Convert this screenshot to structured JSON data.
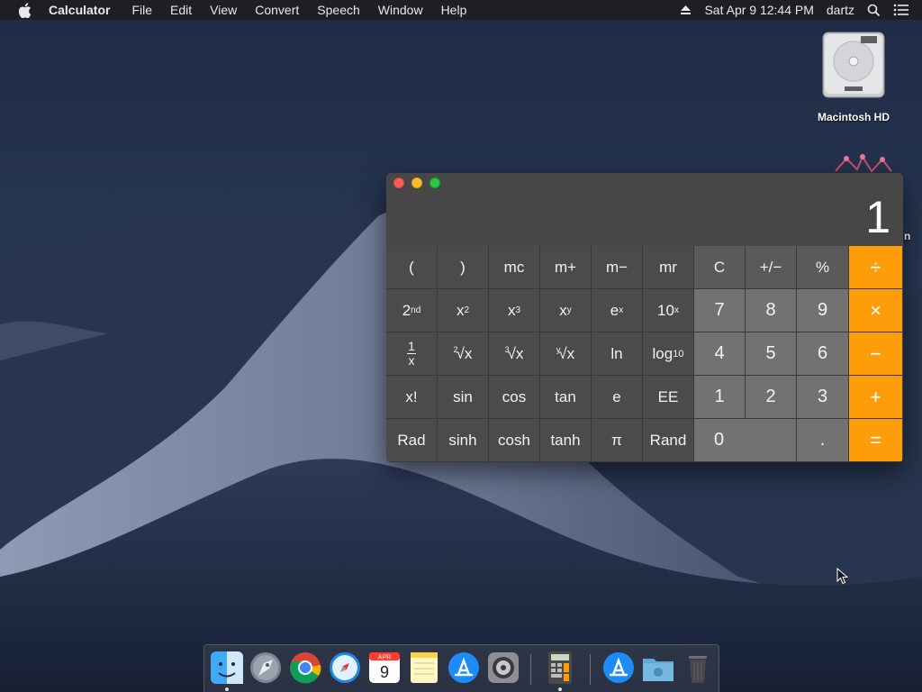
{
  "menubar": {
    "app_name": "Calculator",
    "menus": [
      "File",
      "Edit",
      "View",
      "Convert",
      "Speech",
      "Window",
      "Help"
    ],
    "datetime": "Sat Apr 9  12:44 PM",
    "user": "dartz"
  },
  "desktop": {
    "hd_label": "Macintosh HD",
    "partial_label": "n"
  },
  "calculator": {
    "display_value": "1",
    "rows": [
      [
        "(",
        ")",
        "mc",
        "m+",
        "m−",
        "mr",
        "C",
        "+/−",
        "%",
        "÷"
      ],
      [
        "2nd",
        "x2",
        "x3",
        "xy",
        "ex",
        "10x",
        "7",
        "8",
        "9",
        "×"
      ],
      [
        "1/x",
        "2√x",
        "3√x",
        "y√x",
        "ln",
        "log10",
        "4",
        "5",
        "6",
        "−"
      ],
      [
        "x!",
        "sin",
        "cos",
        "tan",
        "e",
        "EE",
        "1",
        "2",
        "3",
        "+"
      ],
      [
        "Rad",
        "sinh",
        "cosh",
        "tanh",
        "π",
        "Rand",
        "0",
        ".",
        "="
      ]
    ],
    "labels": {
      "paren_open": "(",
      "paren_close": ")",
      "mc": "mc",
      "mplus": "m+",
      "mminus": "m−",
      "mr": "mr",
      "clear": "C",
      "sign": "+/−",
      "percent": "%",
      "divide": "÷",
      "second": "2",
      "second_sup": "nd",
      "x": "x",
      "sup2": "2",
      "sup3": "3",
      "supy": "y",
      "e": "e",
      "supx": "x",
      "ten": "10",
      "seven": "7",
      "eight": "8",
      "nine": "9",
      "multiply": "×",
      "one_over": "1",
      "x_den": "x",
      "idx2": "2",
      "idx3": "3",
      "idxy": "y",
      "sqrt_x": "√x",
      "ln": "ln",
      "log": "log",
      "log_sub": "10",
      "four": "4",
      "five": "5",
      "six": "6",
      "minus": "−",
      "factorial": "x!",
      "sin": "sin",
      "cos": "cos",
      "tan": "tan",
      "econst": "e",
      "ee": "EE",
      "one": "1",
      "two": "2",
      "three": "3",
      "plus": "+",
      "rad": "Rad",
      "sinh": "sinh",
      "cosh": "cosh",
      "tanh": "tanh",
      "pi": "π",
      "rand": "Rand",
      "zero": "0",
      "dot": ".",
      "equals": "="
    },
    "colors": {
      "operator": "#fe9c0a",
      "digit": "#727272",
      "scientific": "#4b4b4b",
      "control": "#5a5a5a"
    }
  },
  "dock": {
    "apps": [
      "finder-icon",
      "launchpad-icon",
      "chrome-icon",
      "safari-icon",
      "calendar-icon",
      "notes-icon",
      "app-store-icon",
      "system-preferences-icon",
      "calculator-icon",
      "app-store-folder-icon",
      "downloads-folder-icon",
      "trash-icon"
    ],
    "calendar_month": "APR",
    "calendar_day": "9"
  }
}
